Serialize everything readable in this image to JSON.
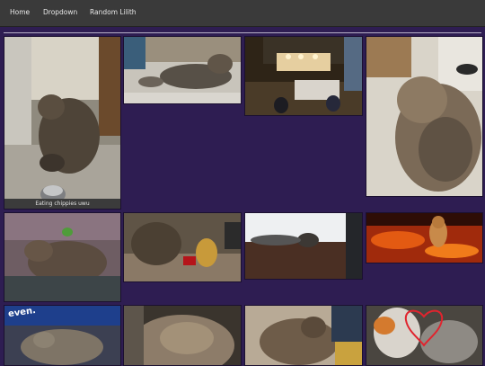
{
  "nav": {
    "items": [
      "Home",
      "Dropdown",
      "Random Lilith"
    ]
  },
  "gallery": {
    "photos": [
      {
        "caption": "Eating chippies uwu"
      },
      {
        "caption": ""
      },
      {
        "caption": ""
      },
      {
        "caption": ""
      },
      {
        "caption": ""
      },
      {
        "caption": ""
      },
      {
        "caption": ""
      },
      {
        "caption": ""
      },
      {
        "caption": "",
        "overlay": "even."
      },
      {
        "caption": ""
      },
      {
        "caption": ""
      },
      {
        "caption": ""
      }
    ]
  },
  "colors": {
    "page_background": "#2e1d52",
    "navbar": "#3a3a3a",
    "nav_text": "#e8e8e8"
  }
}
